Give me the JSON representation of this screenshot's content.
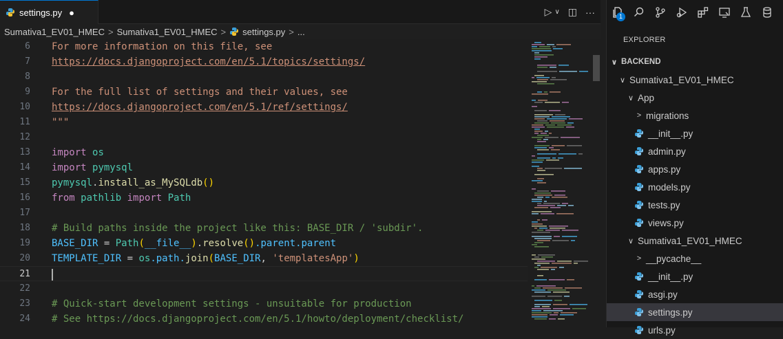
{
  "tab": {
    "label": "settings.py",
    "dirty_marker": "●"
  },
  "editor_actions": {
    "run": "▷",
    "run_dropdown": "∨",
    "split": "◫",
    "more": "···"
  },
  "breadcrumb": [
    {
      "label": "Sumativa1_EV01_HMEC"
    },
    {
      "label": "Sumativa1_EV01_HMEC"
    },
    {
      "label": "settings.py"
    },
    {
      "label": "..."
    }
  ],
  "breadcrumb_separator": ">",
  "code_lines": [
    {
      "n": "6",
      "tokens": [
        {
          "t": "For more information on this file, see",
          "c": "doc"
        }
      ]
    },
    {
      "n": "7",
      "tokens": [
        {
          "t": "https://docs.djangoproject.com/en/5.1/topics/settings/",
          "c": "url"
        }
      ]
    },
    {
      "n": "8",
      "tokens": []
    },
    {
      "n": "9",
      "tokens": [
        {
          "t": "For the full list of settings and their values, see",
          "c": "doc"
        }
      ]
    },
    {
      "n": "10",
      "tokens": [
        {
          "t": "https://docs.djangoproject.com/en/5.1/ref/settings/",
          "c": "url"
        }
      ]
    },
    {
      "n": "11",
      "tokens": [
        {
          "t": "\"\"\"",
          "c": "doc"
        }
      ]
    },
    {
      "n": "12",
      "tokens": []
    },
    {
      "n": "13",
      "tokens": [
        {
          "t": "import ",
          "c": "kw"
        },
        {
          "t": "os",
          "c": "mod"
        }
      ]
    },
    {
      "n": "14",
      "tokens": [
        {
          "t": "import ",
          "c": "kw"
        },
        {
          "t": "pymysql",
          "c": "mod"
        }
      ]
    },
    {
      "n": "15",
      "tokens": [
        {
          "t": "pymysql",
          "c": "mod"
        },
        {
          "t": ".",
          "c": "pl"
        },
        {
          "t": "install_as_MySQLdb",
          "c": "fn"
        },
        {
          "t": "()",
          "c": "yb"
        }
      ]
    },
    {
      "n": "16",
      "tokens": [
        {
          "t": "from ",
          "c": "kw"
        },
        {
          "t": "pathlib",
          "c": "mod"
        },
        {
          "t": " import ",
          "c": "kw"
        },
        {
          "t": "Path",
          "c": "mod"
        }
      ]
    },
    {
      "n": "17",
      "tokens": []
    },
    {
      "n": "18",
      "tokens": [
        {
          "t": "# Build paths inside the project like this: BASE_DIR / 'subdir'.",
          "c": "cm"
        }
      ]
    },
    {
      "n": "19",
      "tokens": [
        {
          "t": "BASE_DIR",
          "c": "var"
        },
        {
          "t": " = ",
          "c": "pl"
        },
        {
          "t": "Path",
          "c": "mod"
        },
        {
          "t": "(",
          "c": "yb"
        },
        {
          "t": "__file__",
          "c": "var"
        },
        {
          "t": ")",
          "c": "yb"
        },
        {
          "t": ".",
          "c": "pl"
        },
        {
          "t": "resolve",
          "c": "fn"
        },
        {
          "t": "()",
          "c": "yb"
        },
        {
          "t": ".parent.parent",
          "c": "var"
        }
      ]
    },
    {
      "n": "20",
      "tokens": [
        {
          "t": "TEMPLATE_DIR",
          "c": "var"
        },
        {
          "t": " = ",
          "c": "pl"
        },
        {
          "t": "os",
          "c": "mod"
        },
        {
          "t": ".path.",
          "c": "var"
        },
        {
          "t": "join",
          "c": "fn"
        },
        {
          "t": "(",
          "c": "yb"
        },
        {
          "t": "BASE_DIR",
          "c": "var"
        },
        {
          "t": ", ",
          "c": "pl"
        },
        {
          "t": "'templatesApp'",
          "c": "str"
        },
        {
          "t": ")",
          "c": "yb"
        }
      ]
    },
    {
      "n": "21",
      "tokens": [],
      "current": true
    },
    {
      "n": "22",
      "tokens": []
    },
    {
      "n": "23",
      "tokens": [
        {
          "t": "# Quick-start development settings - unsuitable for production",
          "c": "cm"
        }
      ]
    },
    {
      "n": "24",
      "tokens": [
        {
          "t": "# See https://docs.djangoproject.com/en/5.1/howto/deployment/checklist/",
          "c": "cm"
        }
      ]
    }
  ],
  "activity_icons": [
    {
      "name": "explorer-icon",
      "badge": "1"
    },
    {
      "name": "search-icon"
    },
    {
      "name": "source-control-icon"
    },
    {
      "name": "run-debug-icon"
    },
    {
      "name": "extensions-icon"
    },
    {
      "name": "remote-explorer-icon"
    },
    {
      "name": "testing-icon"
    },
    {
      "name": "database-icon"
    }
  ],
  "explorer": {
    "title": "EXPLORER",
    "items": [
      {
        "label": "BACKEND",
        "chevron": "∨",
        "kind": "header"
      },
      {
        "label": "Sumativa1_EV01_HMEC",
        "chevron": "∨",
        "kind": "folder",
        "depth": 1
      },
      {
        "label": "App",
        "chevron": "∨",
        "kind": "folder",
        "depth": 2
      },
      {
        "label": "migrations",
        "chevron": ">",
        "kind": "folder",
        "depth": 3
      },
      {
        "label": "__init__.py",
        "kind": "py",
        "depth": 3
      },
      {
        "label": "admin.py",
        "kind": "py",
        "depth": 3
      },
      {
        "label": "apps.py",
        "kind": "py",
        "depth": 3
      },
      {
        "label": "models.py",
        "kind": "py",
        "depth": 3
      },
      {
        "label": "tests.py",
        "kind": "py",
        "depth": 3
      },
      {
        "label": "views.py",
        "kind": "py",
        "depth": 3
      },
      {
        "label": "Sumativa1_EV01_HMEC",
        "chevron": "∨",
        "kind": "folder",
        "depth": 2
      },
      {
        "label": "__pycache__",
        "chevron": ">",
        "kind": "folder",
        "depth": 3
      },
      {
        "label": "__init__.py",
        "kind": "py",
        "depth": 3
      },
      {
        "label": "asgi.py",
        "kind": "py",
        "depth": 3
      },
      {
        "label": "settings.py",
        "kind": "py",
        "depth": 3,
        "selected": true
      },
      {
        "label": "urls.py",
        "kind": "py",
        "depth": 3
      }
    ]
  },
  "colors": {
    "accent": "#0078d4",
    "python_icon": "#3b9fd8"
  }
}
